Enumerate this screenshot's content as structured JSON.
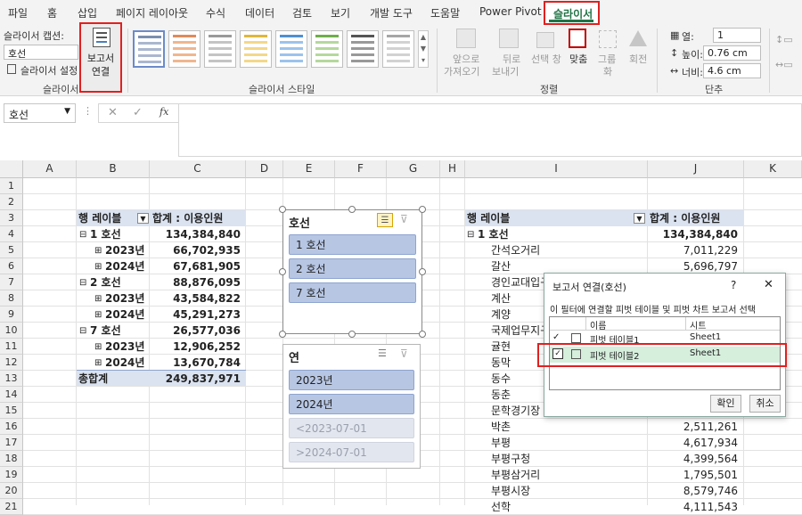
{
  "menu_tabs": [
    "파일",
    "홈",
    "삽입",
    "페이지 레이아웃",
    "수식",
    "데이터",
    "검토",
    "보기",
    "개발 도구",
    "도움말",
    "Power Pivot",
    "슬라이서"
  ],
  "ribbon": {
    "caption_label": "슬라이서 캡션:",
    "caption_value": "호선",
    "settings_label": "슬라이서 설정",
    "group_slicer": "슬라이서",
    "report_connection_line1": "보고서",
    "report_connection_line2": "연결",
    "group_styles": "슬라이서 스타일",
    "bring_forward_1": "앞으로",
    "bring_forward_2": "가져오기",
    "send_backward_1": "뒤로",
    "send_backward_2": "보내기",
    "selection_pane": "선택 창",
    "align": "맞춤",
    "group_btn": "그룹",
    "group_btn2": "화",
    "rotate": "회전",
    "group_arrange": "정렬",
    "columns_label": "열:",
    "columns_value": "1",
    "height_label": "높이:",
    "height_value": "0.76 cm",
    "width_label": "너비:",
    "width_value": "4.6 cm",
    "group_buttons": "단추"
  },
  "name_box": "호선",
  "fx": "fx",
  "columns": [
    "A",
    "B",
    "C",
    "D",
    "E",
    "F",
    "G",
    "H",
    "I",
    "J",
    "K"
  ],
  "rows": [
    "1",
    "2",
    "3",
    "4",
    "5",
    "6",
    "7",
    "8",
    "9",
    "10",
    "11",
    "12",
    "13",
    "14",
    "15",
    "16",
    "17",
    "18",
    "19",
    "20",
    "21"
  ],
  "pivot1": {
    "row_label": "행 레이블",
    "sum_label": "합계 : 이용인원",
    "rows": [
      {
        "label": "1 호선",
        "value": "134,384,840",
        "level": 0
      },
      {
        "label": "2023년",
        "value": "66,702,935",
        "level": 1
      },
      {
        "label": "2024년",
        "value": "67,681,905",
        "level": 1
      },
      {
        "label": "2 호선",
        "value": "88,876,095",
        "level": 0
      },
      {
        "label": "2023년",
        "value": "43,584,822",
        "level": 1
      },
      {
        "label": "2024년",
        "value": "45,291,273",
        "level": 1
      },
      {
        "label": "7 호선",
        "value": "26,577,036",
        "level": 0
      },
      {
        "label": "2023년",
        "value": "12,906,252",
        "level": 1
      },
      {
        "label": "2024년",
        "value": "13,670,784",
        "level": 1
      }
    ],
    "total_label": "총합계",
    "total_value": "249,837,971"
  },
  "slicer_line": {
    "title": "호선",
    "items": [
      "1 호선",
      "2 호선",
      "7 호선"
    ]
  },
  "slicer_year": {
    "title": "연",
    "items": [
      "2023년",
      "2024년",
      "<2023-07-01",
      ">2024-07-01"
    ]
  },
  "pivot2": {
    "row_label": "행 레이블",
    "sum_label": "합계 : 이용인원",
    "group_label": "1 호선",
    "group_value": "134,384,840",
    "rows": [
      {
        "label": "간석오거리",
        "value": "7,011,229"
      },
      {
        "label": "갈산",
        "value": "5,696,797"
      },
      {
        "label": "경인교대입구",
        "value": ""
      },
      {
        "label": "계산",
        "value": ""
      },
      {
        "label": "계양",
        "value": ""
      },
      {
        "label": "국제업무지구",
        "value": ""
      },
      {
        "label": "귤현",
        "value": ""
      },
      {
        "label": "동막",
        "value": ""
      },
      {
        "label": "동수",
        "value": ""
      },
      {
        "label": "동춘",
        "value": ""
      },
      {
        "label": "문학경기장",
        "value": ""
      },
      {
        "label": "박촌",
        "value": "2,511,261"
      },
      {
        "label": "부평",
        "value": "4,617,934"
      },
      {
        "label": "부평구청",
        "value": "4,399,564"
      },
      {
        "label": "부평삼거리",
        "value": "1,795,501"
      },
      {
        "label": "부평시장",
        "value": "8,579,746"
      },
      {
        "label": "선학",
        "value": "4,111,543"
      }
    ]
  },
  "dialog": {
    "title": "보고서 연결(호선)",
    "help": "?",
    "close": "✕",
    "description": "이 필터에 연결할 피벗 테이블 및 피벗 차트 보고서 선택",
    "col_name": "이름",
    "col_sheet": "시트",
    "items": [
      {
        "name": "피벗 테이블1",
        "sheet": "Sheet1",
        "checked": true
      },
      {
        "name": "피벗 테이블2",
        "sheet": "Sheet1",
        "checked": true
      }
    ],
    "ok": "확인",
    "cancel": "취소"
  },
  "colors": {
    "accent": "#217346",
    "highlight": "#e02020",
    "pivot_header": "#dbe3f1",
    "slicer_selected": "#b7c6e3"
  }
}
